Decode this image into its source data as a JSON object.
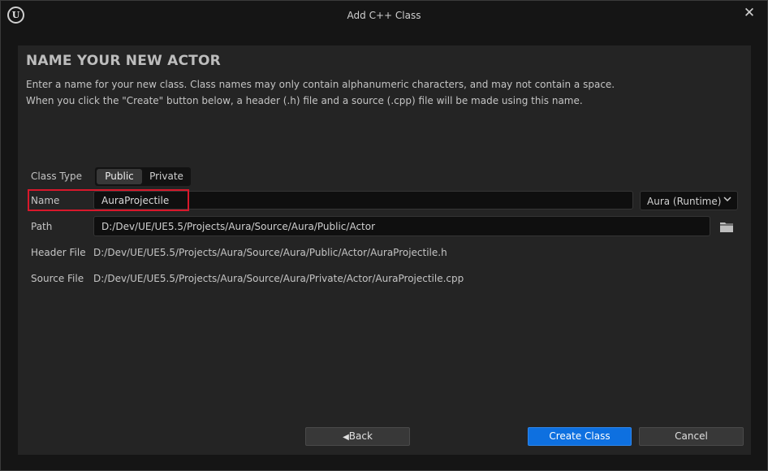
{
  "window": {
    "title": "Add C++ Class",
    "logo_text": "U"
  },
  "header": {
    "heading": "NAME YOUR NEW ACTOR",
    "description_line1": "Enter a name for your new class. Class names may only contain alphanumeric characters, and may not contain a space.",
    "description_line2": "When you click the \"Create\" button below, a header (.h) file and a source (.cpp) file will be made using this name."
  },
  "form": {
    "class_type": {
      "label": "Class Type",
      "options": [
        "Public",
        "Private"
      ],
      "selected": "Public"
    },
    "name": {
      "label": "Name",
      "value": "AuraProjectile"
    },
    "module": {
      "value": "Aura (Runtime)"
    },
    "path": {
      "label": "Path",
      "value": "D:/Dev/UE/UE5.5/Projects/Aura/Source/Aura/Public/Actor"
    },
    "header_file": {
      "label": "Header File",
      "value": "D:/Dev/UE/UE5.5/Projects/Aura/Source/Aura/Public/Actor/AuraProjectile.h"
    },
    "source_file": {
      "label": "Source File",
      "value": "D:/Dev/UE/UE5.5/Projects/Aura/Source/Aura/Private/Actor/AuraProjectile.cpp"
    }
  },
  "buttons": {
    "back": "Back",
    "create": "Create Class",
    "cancel": "Cancel"
  },
  "colors": {
    "accent": "#0e70e0",
    "highlight": "#d8182b",
    "panel": "#242424",
    "background": "#151515"
  },
  "icons": {
    "close": "close-icon",
    "logo": "unreal-logo-icon",
    "folder": "folder-icon",
    "back": "chevron-left-icon",
    "dropdown": "chevron-down-icon"
  }
}
